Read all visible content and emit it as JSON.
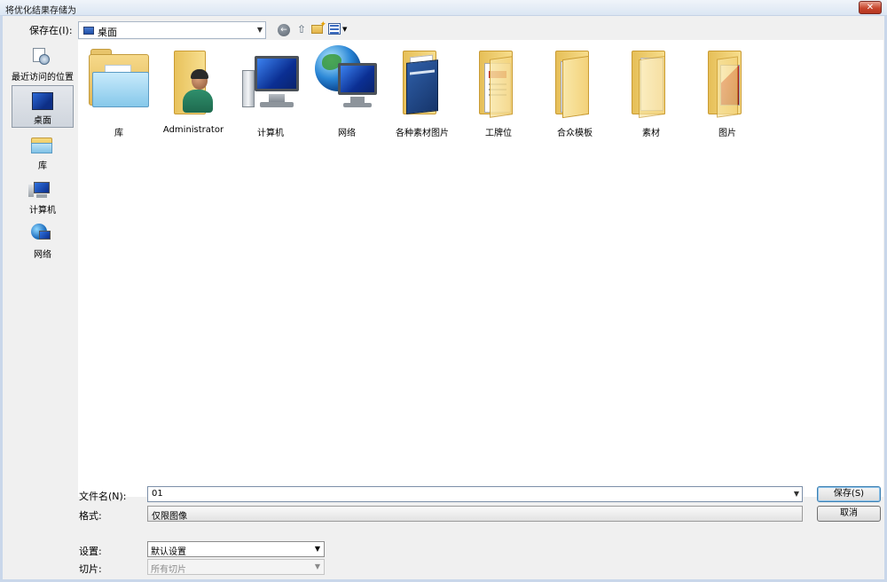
{
  "window": {
    "title": "将优化结果存储为",
    "close_label": "✕"
  },
  "toolbar": {
    "save_in_label": "保存在(I):",
    "location": "桌面",
    "combo_arrow": "▼",
    "back_glyph": "←",
    "up_glyph": "⇧",
    "view_arrow": "▼"
  },
  "places": [
    {
      "label": "最近访问的位置",
      "icon": "recent-places-icon",
      "active": false
    },
    {
      "label": "桌面",
      "icon": "desktop-icon",
      "active": true
    },
    {
      "label": "库",
      "icon": "library-icon",
      "active": false
    },
    {
      "label": "计算机",
      "icon": "computer-icon",
      "active": false
    },
    {
      "label": "网络",
      "icon": "network-icon",
      "active": false
    }
  ],
  "items": [
    {
      "label": "库",
      "icon": "library-icon"
    },
    {
      "label": "Administrator",
      "icon": "user-folder-icon"
    },
    {
      "label": "计算机",
      "icon": "computer-icon"
    },
    {
      "label": "网络",
      "icon": "network-icon"
    },
    {
      "label": "各种素材图片",
      "icon": "folder-icon"
    },
    {
      "label": "工牌位",
      "icon": "folder-icon"
    },
    {
      "label": "合众模板",
      "icon": "folder-icon"
    },
    {
      "label": "素材",
      "icon": "folder-icon"
    },
    {
      "label": "图片",
      "icon": "folder-icon"
    }
  ],
  "form": {
    "filename_label": "文件名(N):",
    "filename_value": "01",
    "format_label": "格式:",
    "format_value": "仅限图像",
    "settings_label": "设置:",
    "settings_value": "默认设置",
    "slices_label": "切片:",
    "slices_value": "所有切片",
    "dropdown_arrow": "▼"
  },
  "buttons": {
    "save": "保存(S)",
    "cancel": "取消"
  }
}
